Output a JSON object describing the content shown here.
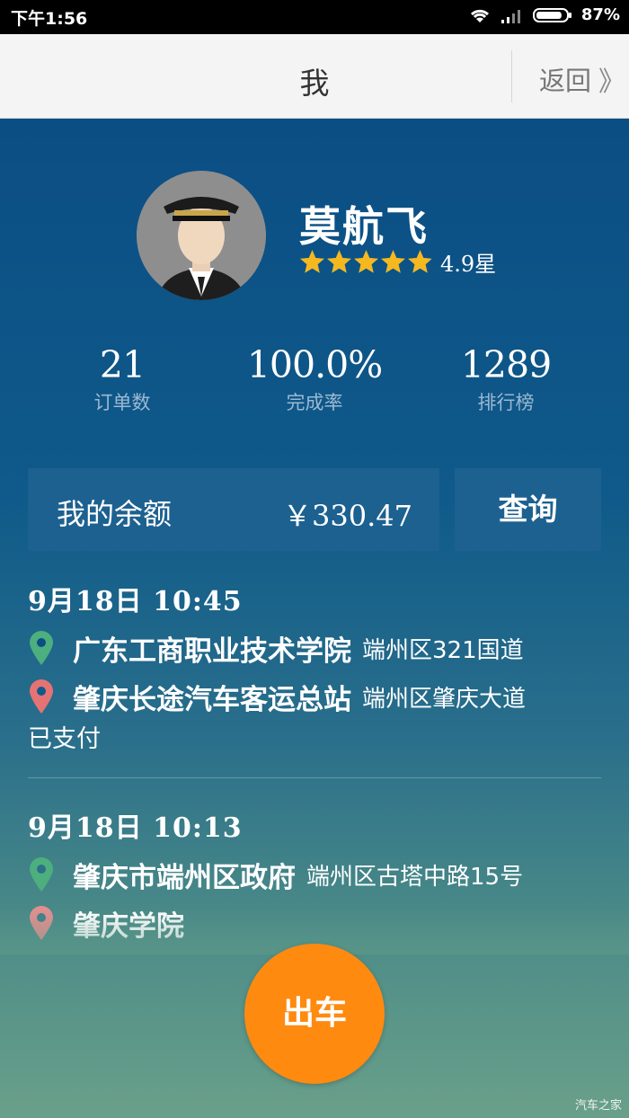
{
  "status_bar": {
    "time": "下午1:56",
    "battery": "87%",
    "battery_level": 0.87
  },
  "header": {
    "title": "我",
    "back_label": "返回",
    "back_chevron": "》"
  },
  "profile": {
    "name": "莫航飞",
    "rating_value": 4.9,
    "rating_text": "4.9星",
    "stars_max": 5,
    "avatar_icon": "driver-avatar"
  },
  "stats": [
    {
      "value": "21",
      "label": "订单数"
    },
    {
      "value": "100.0%",
      "label": "完成率"
    },
    {
      "value": "1289",
      "label": "排行榜"
    }
  ],
  "balance": {
    "label": "我的余额",
    "amount": "￥330.47",
    "query_label": "查询"
  },
  "orders": [
    {
      "time": "9月18日 10:45",
      "from_name": "广东工商职业技术学院",
      "from_addr": "端州区321国道",
      "to_name": "肇庆长途汽车客运总站",
      "to_addr": "端州区肇庆大道",
      "status": "已支付"
    },
    {
      "time": "9月18日 10:13",
      "from_name": "肇庆市端州区政府",
      "from_addr": "端州区古塔中路15号",
      "to_name": "肇庆学院",
      "to_addr": "",
      "status": ""
    }
  ],
  "go_button_label": "出车",
  "watermark": "汽车之家",
  "colors": {
    "accent": "#ff8a10",
    "pin_start": "#4caf7d",
    "pin_end": "#e57373",
    "star": "#f5b81e"
  }
}
